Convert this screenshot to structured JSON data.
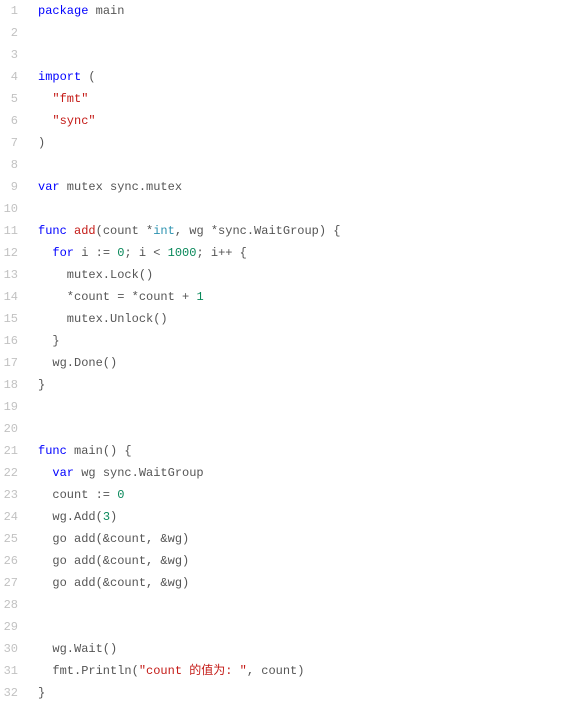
{
  "code": {
    "lines": [
      {
        "n": "1",
        "segments": [
          {
            "t": "package",
            "c": "kw"
          },
          {
            "t": " main",
            "c": "text"
          }
        ]
      },
      {
        "n": "2",
        "segments": []
      },
      {
        "n": "3",
        "segments": []
      },
      {
        "n": "4",
        "segments": [
          {
            "t": "import",
            "c": "kw"
          },
          {
            "t": " (",
            "c": "text"
          }
        ]
      },
      {
        "n": "5",
        "segments": [
          {
            "t": "  ",
            "c": "text"
          },
          {
            "t": "\"fmt\"",
            "c": "str"
          }
        ]
      },
      {
        "n": "6",
        "segments": [
          {
            "t": "  ",
            "c": "text"
          },
          {
            "t": "\"sync\"",
            "c": "str"
          }
        ]
      },
      {
        "n": "7",
        "segments": [
          {
            "t": ")",
            "c": "text"
          }
        ]
      },
      {
        "n": "8",
        "segments": []
      },
      {
        "n": "9",
        "segments": [
          {
            "t": "var",
            "c": "kw"
          },
          {
            "t": " mutex sync.mutex",
            "c": "text"
          }
        ]
      },
      {
        "n": "10",
        "segments": []
      },
      {
        "n": "11",
        "segments": [
          {
            "t": "func",
            "c": "kw"
          },
          {
            "t": " ",
            "c": "text"
          },
          {
            "t": "add",
            "c": "fn"
          },
          {
            "t": "(count *",
            "c": "text"
          },
          {
            "t": "int",
            "c": "type"
          },
          {
            "t": ", wg *sync.WaitGroup) {",
            "c": "text"
          }
        ]
      },
      {
        "n": "12",
        "segments": [
          {
            "t": "  ",
            "c": "text"
          },
          {
            "t": "for",
            "c": "kw"
          },
          {
            "t": " i := ",
            "c": "text"
          },
          {
            "t": "0",
            "c": "num"
          },
          {
            "t": "; i < ",
            "c": "text"
          },
          {
            "t": "1000",
            "c": "num"
          },
          {
            "t": "; i++ {",
            "c": "text"
          }
        ]
      },
      {
        "n": "13",
        "segments": [
          {
            "t": "    mutex.Lock()",
            "c": "text"
          }
        ]
      },
      {
        "n": "14",
        "segments": [
          {
            "t": "    *count = *count + ",
            "c": "text"
          },
          {
            "t": "1",
            "c": "num"
          }
        ]
      },
      {
        "n": "15",
        "segments": [
          {
            "t": "    mutex.Unlock()",
            "c": "text"
          }
        ]
      },
      {
        "n": "16",
        "segments": [
          {
            "t": "  }",
            "c": "text"
          }
        ]
      },
      {
        "n": "17",
        "segments": [
          {
            "t": "  wg.Done()",
            "c": "text"
          }
        ]
      },
      {
        "n": "18",
        "segments": [
          {
            "t": "}",
            "c": "text"
          }
        ]
      },
      {
        "n": "19",
        "segments": []
      },
      {
        "n": "20",
        "segments": []
      },
      {
        "n": "21",
        "segments": [
          {
            "t": "func",
            "c": "kw"
          },
          {
            "t": " main() {",
            "c": "text"
          }
        ]
      },
      {
        "n": "22",
        "segments": [
          {
            "t": "  ",
            "c": "text"
          },
          {
            "t": "var",
            "c": "kw"
          },
          {
            "t": " wg sync.WaitGroup",
            "c": "text"
          }
        ]
      },
      {
        "n": "23",
        "segments": [
          {
            "t": "  count := ",
            "c": "text"
          },
          {
            "t": "0",
            "c": "num"
          }
        ]
      },
      {
        "n": "24",
        "segments": [
          {
            "t": "  wg.Add(",
            "c": "text"
          },
          {
            "t": "3",
            "c": "num"
          },
          {
            "t": ")",
            "c": "text"
          }
        ]
      },
      {
        "n": "25",
        "segments": [
          {
            "t": "  go add(&count, &wg)",
            "c": "text"
          }
        ]
      },
      {
        "n": "26",
        "segments": [
          {
            "t": "  go add(&count, &wg)",
            "c": "text"
          }
        ]
      },
      {
        "n": "27",
        "segments": [
          {
            "t": "  go add(&count, &wg)",
            "c": "text"
          }
        ]
      },
      {
        "n": "28",
        "segments": []
      },
      {
        "n": "29",
        "segments": []
      },
      {
        "n": "30",
        "segments": [
          {
            "t": "  wg.Wait()",
            "c": "text"
          }
        ]
      },
      {
        "n": "31",
        "segments": [
          {
            "t": "  fmt.Println(",
            "c": "text"
          },
          {
            "t": "\"count 的值为: \"",
            "c": "str"
          },
          {
            "t": ", count)",
            "c": "text"
          }
        ]
      },
      {
        "n": "32",
        "segments": [
          {
            "t": "}",
            "c": "text"
          }
        ]
      }
    ]
  }
}
